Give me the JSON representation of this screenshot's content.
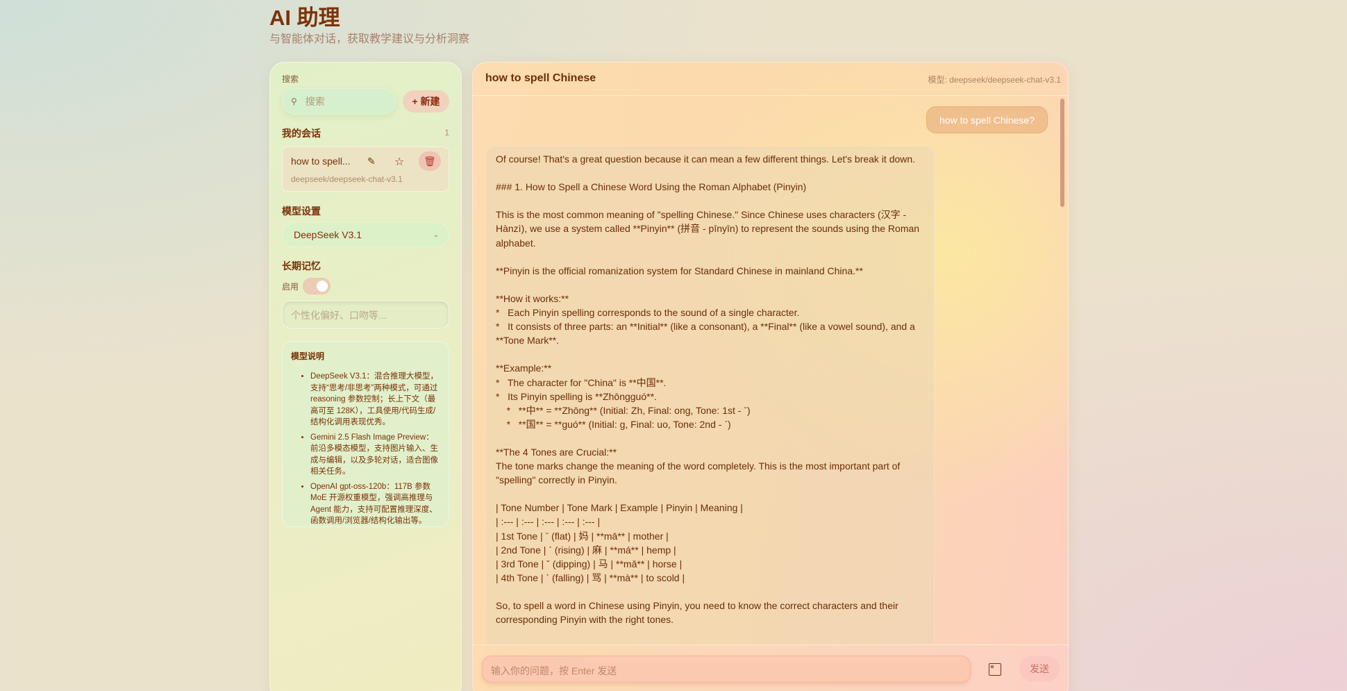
{
  "header": {
    "title": "AI 助理",
    "subtitle": "与智能体对话，获取教学建议与分析洞察"
  },
  "sidebar": {
    "search_label": "搜索",
    "search_placeholder": "搜索",
    "new_button": "+ 新建",
    "conversations_heading": "我的会话",
    "conversations_count": "1",
    "conversations": [
      {
        "title": "how to spell...",
        "model": "deepseek/deepseek-chat-v3.1"
      }
    ],
    "model_settings_heading": "模型设置",
    "model_selected": "DeepSeek V3.1",
    "memory_heading": "长期记忆",
    "memory_toggle_label": "启用",
    "memory_enabled": true,
    "memory_placeholder": "个性化偏好、口吻等...",
    "info_heading": "模型说明",
    "info_items": [
      "DeepSeek V3.1：混合推理大模型，支持“思考/非思考”两种模式，可通过 reasoning 参数控制；长上下文（最高可至 128K），工具使用/代码生成/结构化调用表现优秀。",
      "Gemini 2.5 Flash Image Preview：前沿多模态模型，支持图片输入、生成与编辑，以及多轮对话，适合图像相关任务。",
      "OpenAI gpt-oss-120b：117B 参数 MoE 开源权重模型，强调高推理与 Agent 能力，支持可配置推理深度、函数调用/浏览器/结构化输出等。"
    ]
  },
  "chat": {
    "title": "how to spell Chinese",
    "model_label": "模型: deepseek/deepseek-chat-v3.1",
    "user_message": "how to spell Chinese?",
    "assistant_message": "Of course! That's a great question because it can mean a few different things. Let's break it down.\n\n### 1. How to Spell a Chinese Word Using the Roman Alphabet (Pinyin)\n\nThis is the most common meaning of \"spelling Chinese.\" Since Chinese uses characters (汉字 - Hànzì), we use a system called **Pinyin** (拼音 - pīnyīn) to represent the sounds using the Roman alphabet.\n\n**Pinyin is the official romanization system for Standard Chinese in mainland China.**\n\n**How it works:**\n*   Each Pinyin spelling corresponds to the sound of a single character.\n*   It consists of three parts: an **Initial** (like a consonant), a **Final** (like a vowel sound), and a **Tone Mark**.\n\n**Example:**\n*   The character for \"China\" is **中国**.\n*   Its Pinyin spelling is **Zhōngguó**.\n    *   **中** = **Zhōng** (Initial: Zh, Final: ong, Tone: 1st - ˉ)\n    *   **国** = **guó** (Initial: g, Final: uo, Tone: 2nd - ˊ)\n\n**The 4 Tones are Crucial:**\nThe tone marks change the meaning of the word completely. This is the most important part of \"spelling\" correctly in Pinyin.\n\n| Tone Number | Tone Mark | Example | Pinyin | Meaning |\n| :--- | :--- | :--- | :--- | :--- |\n| 1st Tone | ˉ (flat) | 妈 | **mā** | mother |\n| 2nd Tone | ˊ (rising) | 麻 | **má** | hemp |\n| 3rd Tone | ˇ (dipping) | 马 | **mǎ** | horse |\n| 4th Tone | ˋ (falling) | 骂 | **mà** | to scold |\n\nSo, to spell a word in Chinese using Pinyin, you need to know the correct characters and their corresponding Pinyin with the right tones.",
    "input_placeholder": "输入你的问题，按 Enter 发送",
    "send_button": "发送"
  }
}
